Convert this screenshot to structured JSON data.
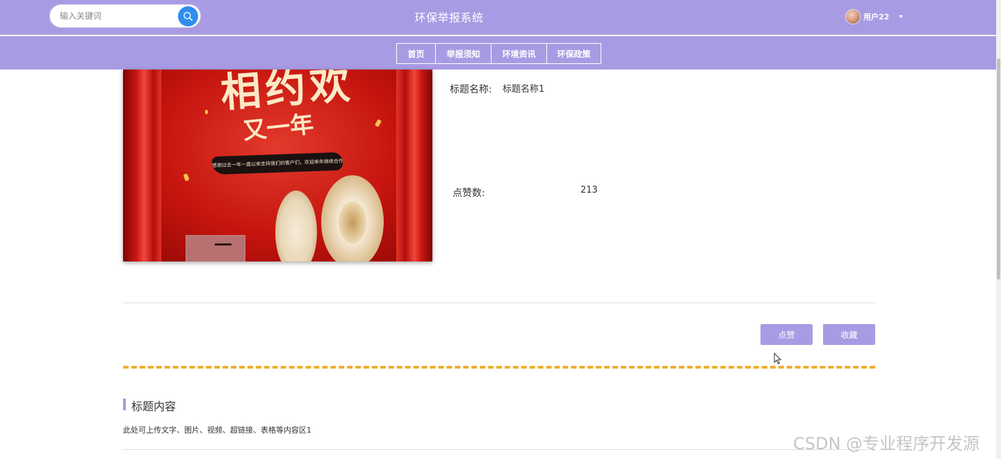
{
  "header": {
    "search_placeholder": "输入关键词",
    "site_title": "环保举报系统",
    "user_name": "用户22"
  },
  "nav": {
    "items": [
      {
        "label": "首页"
      },
      {
        "label": "举报须知"
      },
      {
        "label": "环境资讯"
      },
      {
        "label": "环保政策"
      }
    ]
  },
  "detail": {
    "image_calligraphy_line1": "相约欢",
    "image_calligraphy_line2": "又一年",
    "image_banner_text": "感谢过去一年一直以来支持我们的客户们，欢迎来年继续合作，祝你大吉！",
    "title_label": "标题名称:",
    "title_value": "标题名称1",
    "likes_label": "点赞数:",
    "likes_value": "213"
  },
  "actions": {
    "like_label": "点赞",
    "favorite_label": "收藏"
  },
  "content": {
    "section_title": "标题内容",
    "body": "此处可上传文字、图片、视频、超链接、表格等内容区1"
  },
  "watermark": "CSDN @专业程序开发源",
  "colors": {
    "header_bg": "#a99be3",
    "accent_button": "#a99be3",
    "search_button": "#2f8ef0",
    "dashed_divider": "#f0b030"
  },
  "icons": {
    "search": "search-icon",
    "user_caret": "caret-down-icon"
  }
}
